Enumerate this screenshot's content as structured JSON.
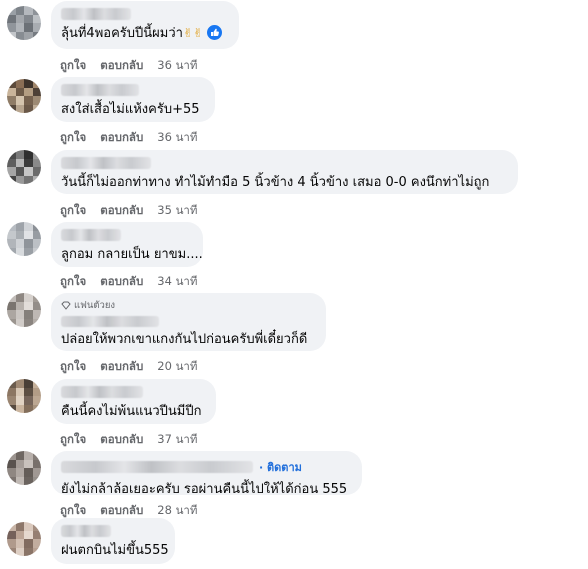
{
  "comments": [
    {
      "text": "ลุ้นที่4พอครับปีนี้ผมว่า",
      "emoji": "✌✌",
      "like": "like-icon",
      "act_like": "ถูกใจ",
      "act_reply": "ตอบกลับ",
      "time": "36 นาที"
    },
    {
      "text": "สงใส่เสื้อไม่แห้งครับ+55",
      "act_like": "ถูกใจ",
      "act_reply": "ตอบกลับ",
      "time": "36 นาที"
    },
    {
      "text": "วันนี้ก็ไม่ออกท่าทาง ทำไม้ทำมือ 5 นิ้วข้าง 4 นิ้วข้าง เสมอ 0-0 คงนึกท่าไม่ถูก",
      "act_like": "ถูกใจ",
      "act_reply": "ตอบกลับ",
      "time": "35 นาที"
    },
    {
      "text": "ลูกอม กลายเป็น ยาขม....",
      "act_like": "ถูกใจ",
      "act_reply": "ตอบกลับ",
      "time": "34 นาที"
    },
    {
      "badge": "แฟนตัวยง",
      "text": "ปล่อยให้พวกเขาแกงกันไปก่อนครับพี่เดี๋ยวก็ดี",
      "act_like": "ถูกใจ",
      "act_reply": "ตอบกลับ",
      "time": "20 นาที"
    },
    {
      "text": "คืนนี้คงไม่พ้นแนวปีนมีปีก",
      "act_like": "ถูกใจ",
      "act_reply": "ตอบกลับ",
      "time": "37 นาที"
    },
    {
      "follow": "· ติดตาม",
      "text": "ยังไม่กล้าล้อเยอะครับ รอผ่านคืนนี้ไปให้ได้ก่อน 555",
      "act_like": "ถูกใจ",
      "act_reply": "ตอบกลับ",
      "time": "28 นาที"
    },
    {
      "text": "ฝนตกบินไม่ขึ้น555"
    }
  ],
  "colors": {
    "bubble": "#f0f2f5",
    "meta": "#65676b",
    "link": "#216fdb",
    "like": "#1877f2"
  }
}
